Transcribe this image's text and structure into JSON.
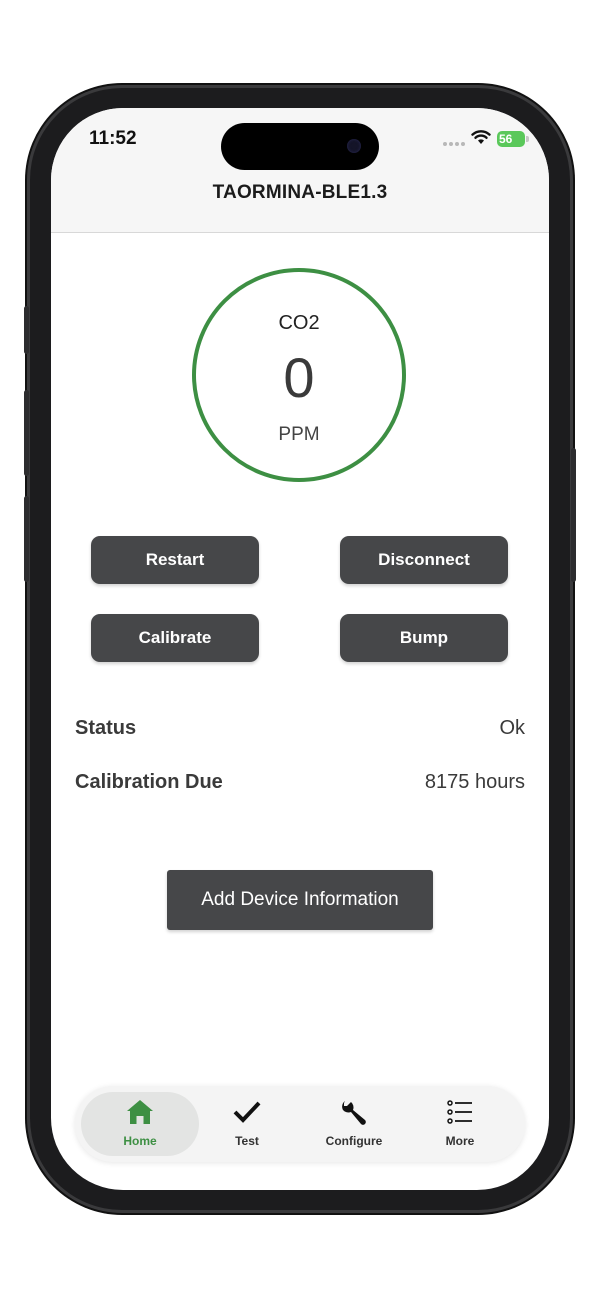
{
  "status_bar": {
    "time": "11:52",
    "battery": "56"
  },
  "header": {
    "title": "TAORMINA-BLE1.3"
  },
  "gauge": {
    "gas": "CO2",
    "value": "0",
    "unit": "PPM",
    "ring_color": "#3d8f43"
  },
  "actions": {
    "restart": "Restart",
    "disconnect": "Disconnect",
    "calibrate": "Calibrate",
    "bump": "Bump"
  },
  "info": {
    "status_label": "Status",
    "status_value": "Ok",
    "calibration_label": "Calibration Due",
    "calibration_value": "8175 hours"
  },
  "add_device_label": "Add Device Information",
  "tabs": [
    {
      "label": "Home",
      "icon": "home-icon",
      "active": true
    },
    {
      "label": "Test",
      "icon": "check-icon",
      "active": false
    },
    {
      "label": "Configure",
      "icon": "wrench-icon",
      "active": false
    },
    {
      "label": "More",
      "icon": "list-icon",
      "active": false
    }
  ],
  "colors": {
    "accent": "#3d8f43",
    "button": "#464749"
  }
}
